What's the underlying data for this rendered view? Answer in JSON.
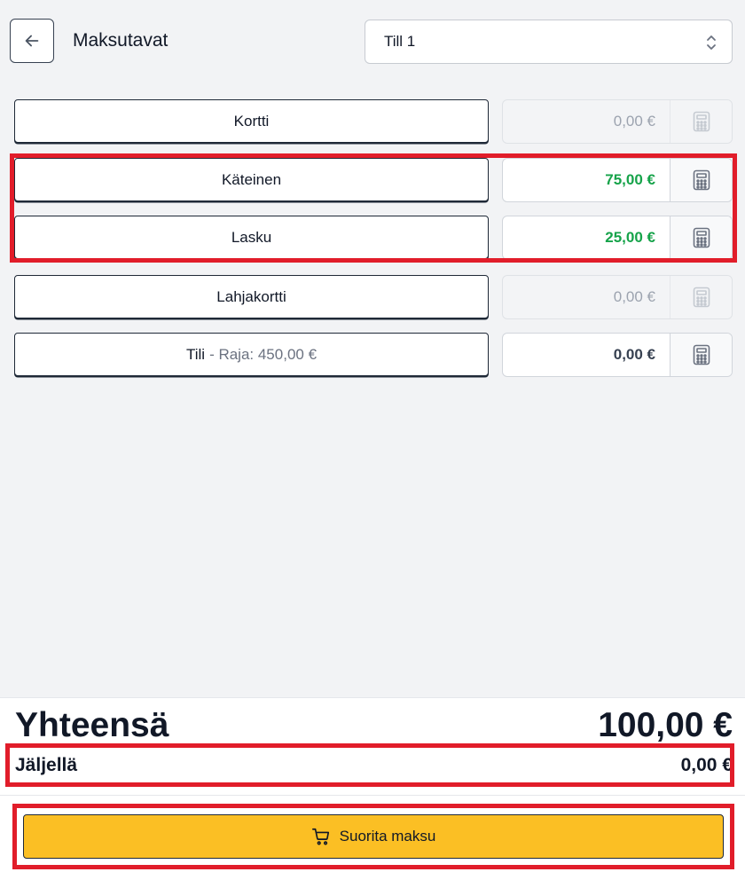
{
  "header": {
    "title": "Maksutavat",
    "till_select": {
      "value": "Till 1"
    }
  },
  "methods": [
    {
      "label": "Kortti",
      "sublabel": "",
      "amount": "0,00 €",
      "state": "disabled"
    },
    {
      "label": "Käteinen",
      "sublabel": "",
      "amount": "75,00 €",
      "state": "paid"
    },
    {
      "label": "Lasku",
      "sublabel": "",
      "amount": "25,00 €",
      "state": "paid"
    },
    {
      "label": "Lahjakortti",
      "sublabel": "",
      "amount": "0,00 €",
      "state": "disabled"
    },
    {
      "label": "Tili",
      "sublabel": "- Raja: 450,00 €",
      "amount": "0,00 €",
      "state": "enabled"
    }
  ],
  "summary": {
    "total_label": "Yhteensä",
    "total_value": "100,00 €",
    "remaining_label": "Jäljellä",
    "remaining_value": "0,00 €"
  },
  "actions": {
    "pay_label": "Suorita maksu"
  },
  "colors": {
    "accent": "#fbbf24",
    "paid_amount": "#16a34a",
    "highlight": "#e11d2a"
  },
  "icons": {
    "back": "arrow-left-icon",
    "select": "chevron-up-down-icon",
    "calculator": "calculator-icon",
    "pay": "shopping-cart-icon"
  }
}
